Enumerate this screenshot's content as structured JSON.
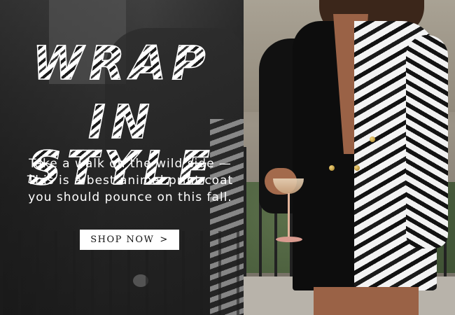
{
  "banner": {
    "headline_line1": "WRAP",
    "headline_line2": "IN STYLE",
    "body": "Take a walk on the wild side — This is a best animal print coat you should pounce on this fall.",
    "cta": {
      "label": "SHOP NOW",
      "arrow_icon": "chevron-right-icon",
      "arrow_glyph": ">"
    }
  },
  "colors": {
    "text": "#ffffff",
    "cta_background": "#ffffff",
    "cta_text": "#111111"
  }
}
